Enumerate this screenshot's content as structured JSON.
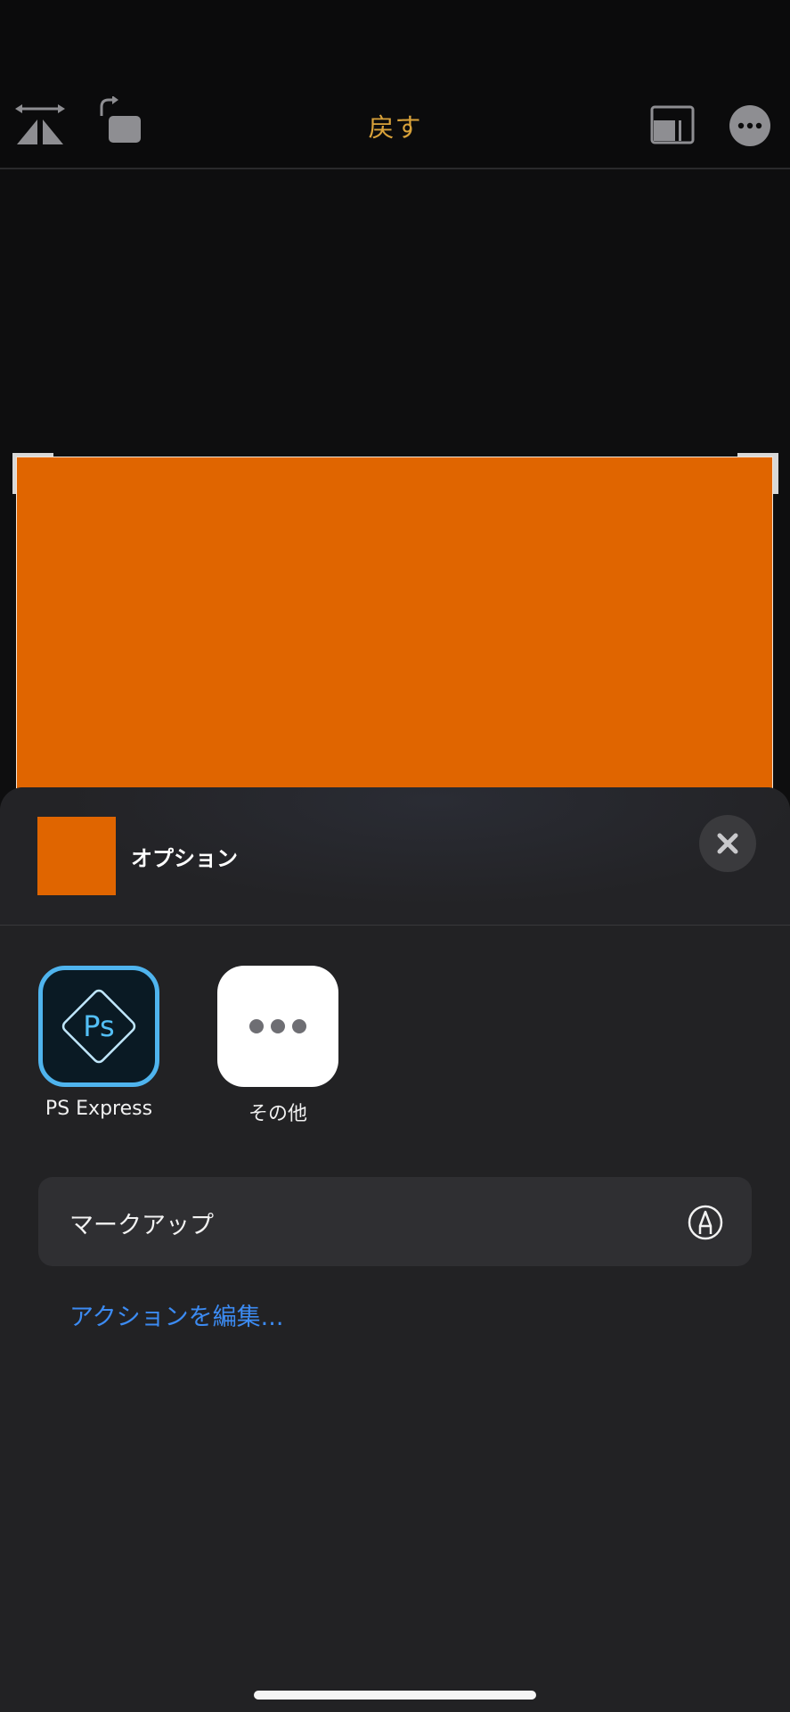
{
  "toolbar": {
    "reset_label": "戻す",
    "accent_color": "#d9a23a",
    "icons": [
      "flip-horizontal-icon",
      "rotate-icon",
      "aspect-ratio-icon",
      "more-icon"
    ]
  },
  "photo": {
    "fill_color": "#e06500"
  },
  "share_sheet": {
    "title": "オプション",
    "close_icon": "close-icon",
    "apps": [
      {
        "label": "PS Express",
        "icon": "ps-express-icon"
      },
      {
        "label": "その他",
        "icon": "more-apps-icon"
      }
    ],
    "markup": {
      "label": "マークアップ",
      "icon": "markup-pen-icon"
    },
    "edit_actions_label": "アクションを編集...",
    "link_color": "#3c8bf2"
  }
}
